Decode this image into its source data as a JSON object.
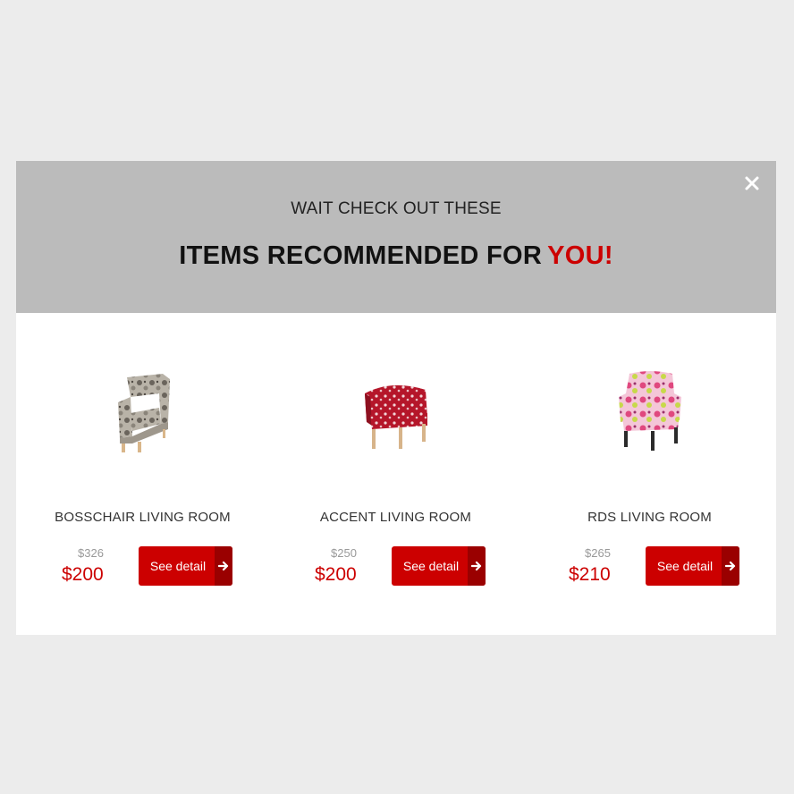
{
  "popup": {
    "subtitle": "WAIT CHECK OUT THESE",
    "headline_main": "ITEMS RECOMMENDED FOR",
    "headline_accent": "YOU!",
    "close_icon": "close-icon"
  },
  "colors": {
    "accent": "#cc0000",
    "header_bg": "#bbbbbb",
    "page_bg": "#ececec"
  },
  "products": [
    {
      "name": "BOSSCHAIR LIVING ROOM",
      "old_price": "$326",
      "price": "$200",
      "button_label": "See detail",
      "image": "gray-floral-armchair"
    },
    {
      "name": "ACCENT LIVING ROOM",
      "old_price": "$250",
      "price": "$200",
      "button_label": "See detail",
      "image": "red-patterned-tub-chair"
    },
    {
      "name": "RDS LIVING ROOM",
      "old_price": "$265",
      "price": "$210",
      "button_label": "See detail",
      "image": "pink-floral-wingback-chair"
    }
  ]
}
